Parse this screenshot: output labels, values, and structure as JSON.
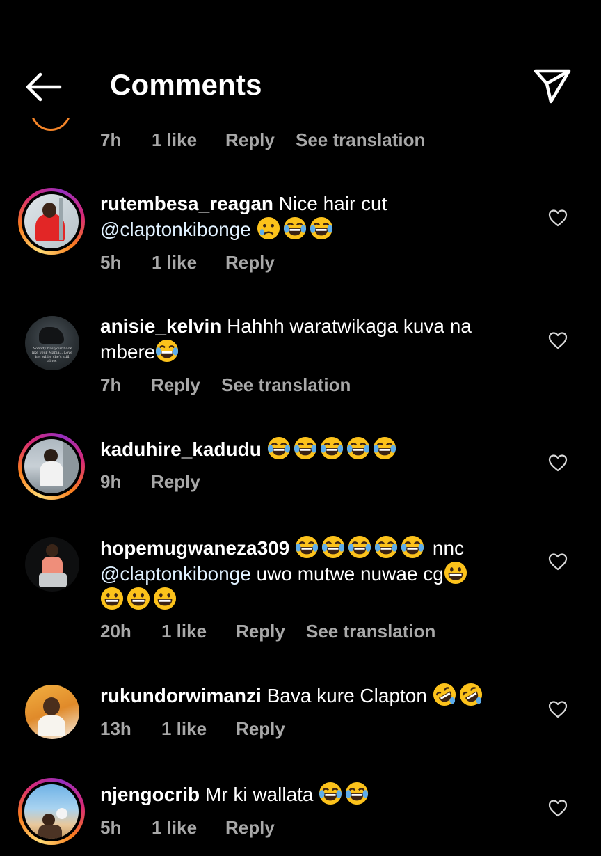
{
  "header": {
    "title": "Comments"
  },
  "top_meta": {
    "time": "7h",
    "likes": "1 like",
    "reply": "Reply",
    "translate": "See translation"
  },
  "comments": [
    {
      "username": "rutembesa_reagan",
      "text": "Nice hair cut",
      "mention": "@claptonkibonge",
      "time": "5h",
      "likes": "1 like",
      "reply": "Reply"
    },
    {
      "username": "anisie_kelvin",
      "text": "Hahhh waratwikaga kuva na",
      "text2": "mbere",
      "time": "7h",
      "reply": "Reply",
      "translate": "See translation"
    },
    {
      "username": "kaduhire_kadudu",
      "time": "9h",
      "reply": "Reply"
    },
    {
      "username": "hopemugwaneza309",
      "text_after": "nnc",
      "mention": "@claptonkibonge",
      "text2": "uwo mutwe nuwae cg",
      "time": "20h",
      "likes": "1 like",
      "reply": "Reply",
      "translate": "See translation"
    },
    {
      "username": "rukundorwimanzi",
      "text": "Bava kure Clapton",
      "time": "13h",
      "likes": "1 like",
      "reply": "Reply"
    },
    {
      "username": "njengocrib",
      "text": "Mr ki wallata",
      "time": "5h",
      "likes": "1 like",
      "reply": "Reply"
    }
  ],
  "avatar_texts": {
    "anisie_kelvin": "Nobody has your back like your Mama... Love her while she's still alive."
  },
  "colors": {
    "background": "#000000",
    "meta": "#a8a8a8",
    "ring_start": "#feda75",
    "ring_mid": "#d62976",
    "ring_end": "#962fbf"
  },
  "icons": [
    "back-arrow-icon",
    "send-icon",
    "heart-icon",
    "emoji-laugh-cry",
    "emoji-sad-tear",
    "emoji-grin",
    "emoji-rofl"
  ]
}
